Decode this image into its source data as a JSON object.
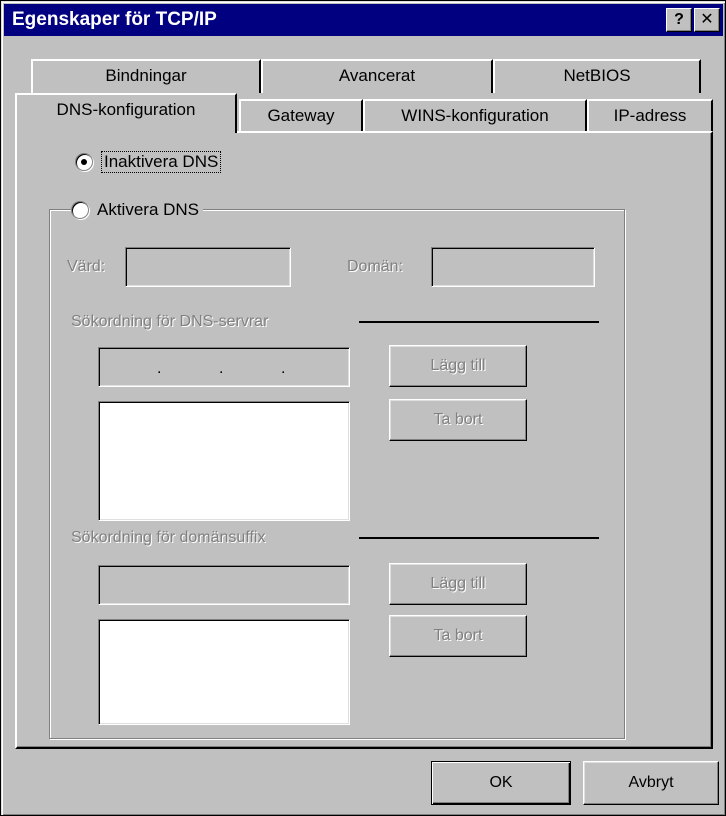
{
  "window": {
    "title": "Egenskaper för TCP/IP",
    "help_button": "?",
    "close_button": "✕"
  },
  "tabs_back": [
    {
      "label": "Bindningar"
    },
    {
      "label": "Avancerat"
    },
    {
      "label": "NetBIOS"
    }
  ],
  "tabs_front": [
    {
      "label": "DNS-konfiguration",
      "active": true
    },
    {
      "label": "Gateway"
    },
    {
      "label": "WINS-konfiguration"
    },
    {
      "label": "IP-adress"
    }
  ],
  "dns": {
    "disable_label": "Inaktivera DNS",
    "disable_selected": true,
    "enable_label": "Aktivera DNS",
    "enable_selected": false,
    "host_label": "Värd:",
    "host_value": "",
    "domain_label": "Domän:",
    "domain_value": "",
    "server_order_label": "Sökordning för DNS-servrar",
    "server_ip": [
      "",
      "",
      "",
      ""
    ],
    "server_ip_separator": ".",
    "add_server_label": "Lägg till",
    "remove_server_label": "Ta bort",
    "suffix_order_label": "Sökordning för domänsuffix",
    "suffix_value": "",
    "add_suffix_label": "Lägg till",
    "remove_suffix_label": "Ta bort"
  },
  "footer": {
    "ok_label": "OK",
    "cancel_label": "Avbryt"
  }
}
